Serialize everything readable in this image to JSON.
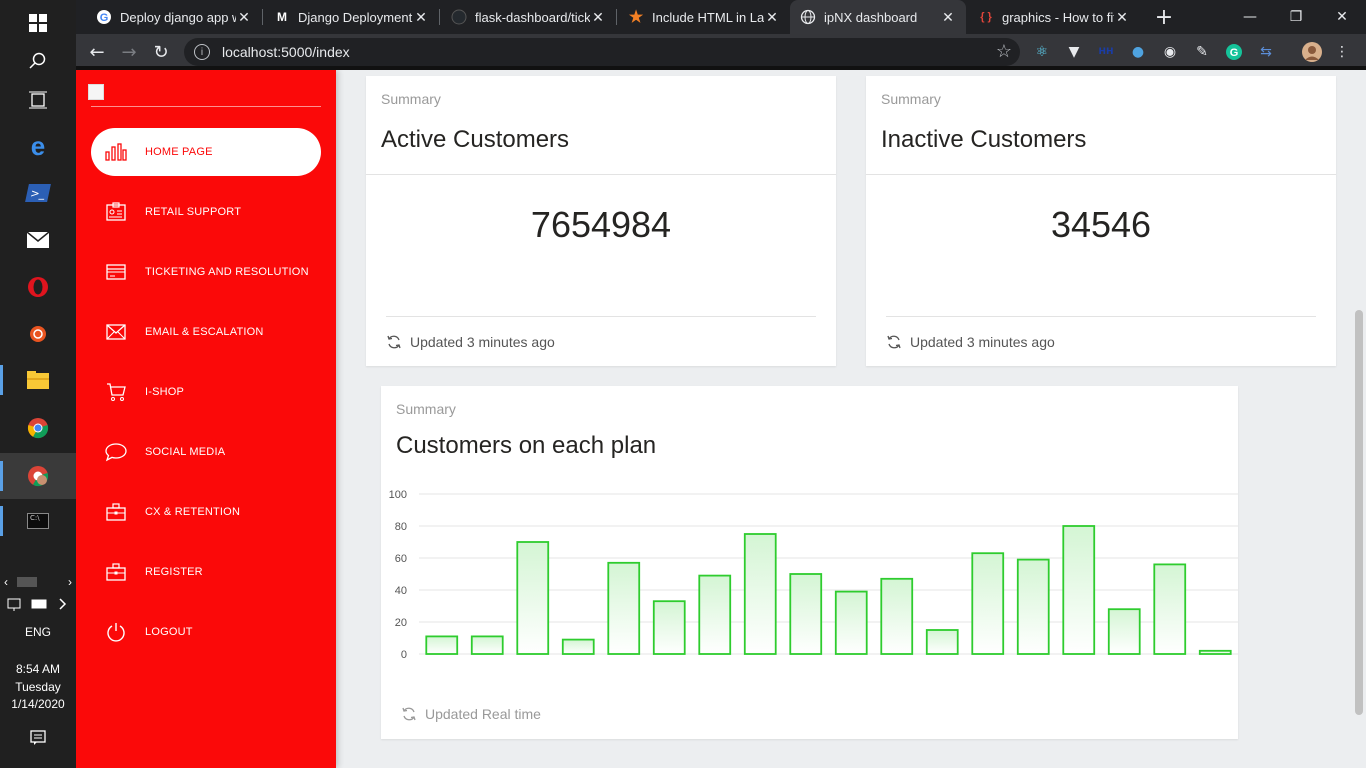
{
  "taskbar": {
    "icons": [
      "windows-start-icon",
      "search-icon",
      "task-view-icon",
      "edge-icon",
      "powershell-icon",
      "mail-icon",
      "opera-icon",
      "ubuntu-icon",
      "file-explorer-icon",
      "chrome-icon",
      "chrome-profile-icon",
      "terminal-icon"
    ],
    "language": "ENG",
    "time": "8:54 AM",
    "day": "Tuesday",
    "date": "1/14/2020"
  },
  "browser": {
    "tabs": [
      {
        "title": "Deploy django app w",
        "icon": "google-icon"
      },
      {
        "title": "Django Deployment C",
        "icon": "medium-icon"
      },
      {
        "title": "flask-dashboard/ticke",
        "icon": "github-icon"
      },
      {
        "title": "Include HTML in LaTe",
        "icon": "star-icon"
      },
      {
        "title": "ipNX dashboard",
        "icon": "globe-icon",
        "active": true
      },
      {
        "title": "graphics - How to fit",
        "icon": "tex-icon"
      }
    ],
    "url": "localhost:5000/index"
  },
  "sidebar": {
    "items": [
      {
        "label": "HOME PAGE",
        "icon": "bar-chart-icon",
        "active": true
      },
      {
        "label": "RETAIL SUPPORT",
        "icon": "id-card-icon"
      },
      {
        "label": "TICKETING AND RESOLUTION",
        "icon": "credit-card-icon"
      },
      {
        "label": "EMAIL & ESCALATION",
        "icon": "envelope-icon"
      },
      {
        "label": "I-SHOP",
        "icon": "cart-icon"
      },
      {
        "label": "SOCIAL MEDIA",
        "icon": "chat-bubble-icon"
      },
      {
        "label": "CX & RETENTION",
        "icon": "briefcase-icon"
      },
      {
        "label": "REGISTER",
        "icon": "briefcase-icon"
      },
      {
        "label": "LOGOUT",
        "icon": "power-icon"
      }
    ]
  },
  "cards": {
    "active": {
      "category": "Summary",
      "title": "Active Customers",
      "value": "7654984",
      "footer": "Updated 3 minutes ago"
    },
    "inactive": {
      "category": "Summary",
      "title": "Inactive Customers",
      "value": "34546",
      "footer": "Updated 3 minutes ago"
    },
    "plan": {
      "category": "Summary",
      "title": "Customers on each plan",
      "footer": "Updated Real time"
    }
  },
  "colors": {
    "sidebar": "#fb0909",
    "bar_stroke": "#2ecc2e",
    "bar_fill": "#d4f5d4"
  },
  "chart_data": {
    "type": "bar",
    "title": "",
    "xlabel": "",
    "ylabel": "",
    "ylim": [
      0,
      100
    ],
    "yticks": [
      0,
      20,
      40,
      60,
      80,
      100
    ],
    "values": [
      11,
      11,
      70,
      9,
      57,
      33,
      49,
      75,
      50,
      39,
      47,
      15,
      63,
      59,
      80,
      28,
      56,
      2
    ],
    "grid": true
  }
}
